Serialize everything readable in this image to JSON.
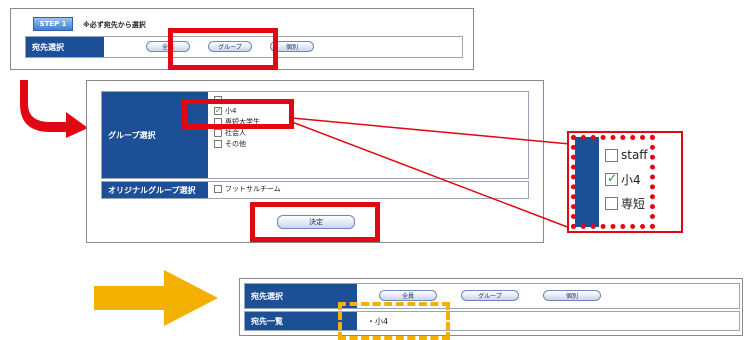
{
  "step1": {
    "badge": "STEP 1",
    "note": "※必ず宛先から選択",
    "label": "宛先選択",
    "buttons": [
      "全員",
      "グループ",
      "個別"
    ]
  },
  "group_panel": {
    "group_label": "グループ選択",
    "group_items": [
      {
        "label": "",
        "checked": false
      },
      {
        "label": "小4",
        "checked": true
      },
      {
        "label": "専短大学生",
        "checked": false
      },
      {
        "label": "社会人",
        "checked": false
      },
      {
        "label": "その他",
        "checked": false
      }
    ],
    "original_label": "オリジナルグループ選択",
    "original_item": "フットサルチーム",
    "confirm": "決定"
  },
  "zoom": {
    "items": [
      {
        "label": "staff",
        "checked": false
      },
      {
        "label": "小4",
        "checked": true
      },
      {
        "label": "専短",
        "checked": false
      }
    ]
  },
  "result": {
    "label1": "宛先選択",
    "label2": "宛先一覧",
    "buttons": [
      "全員",
      "グループ",
      "個別"
    ],
    "list_value": "・小4"
  },
  "colors": {
    "primary_blue": "#1d4f96",
    "highlight_red": "#e30613",
    "arrow_yellow": "#f4b000"
  }
}
